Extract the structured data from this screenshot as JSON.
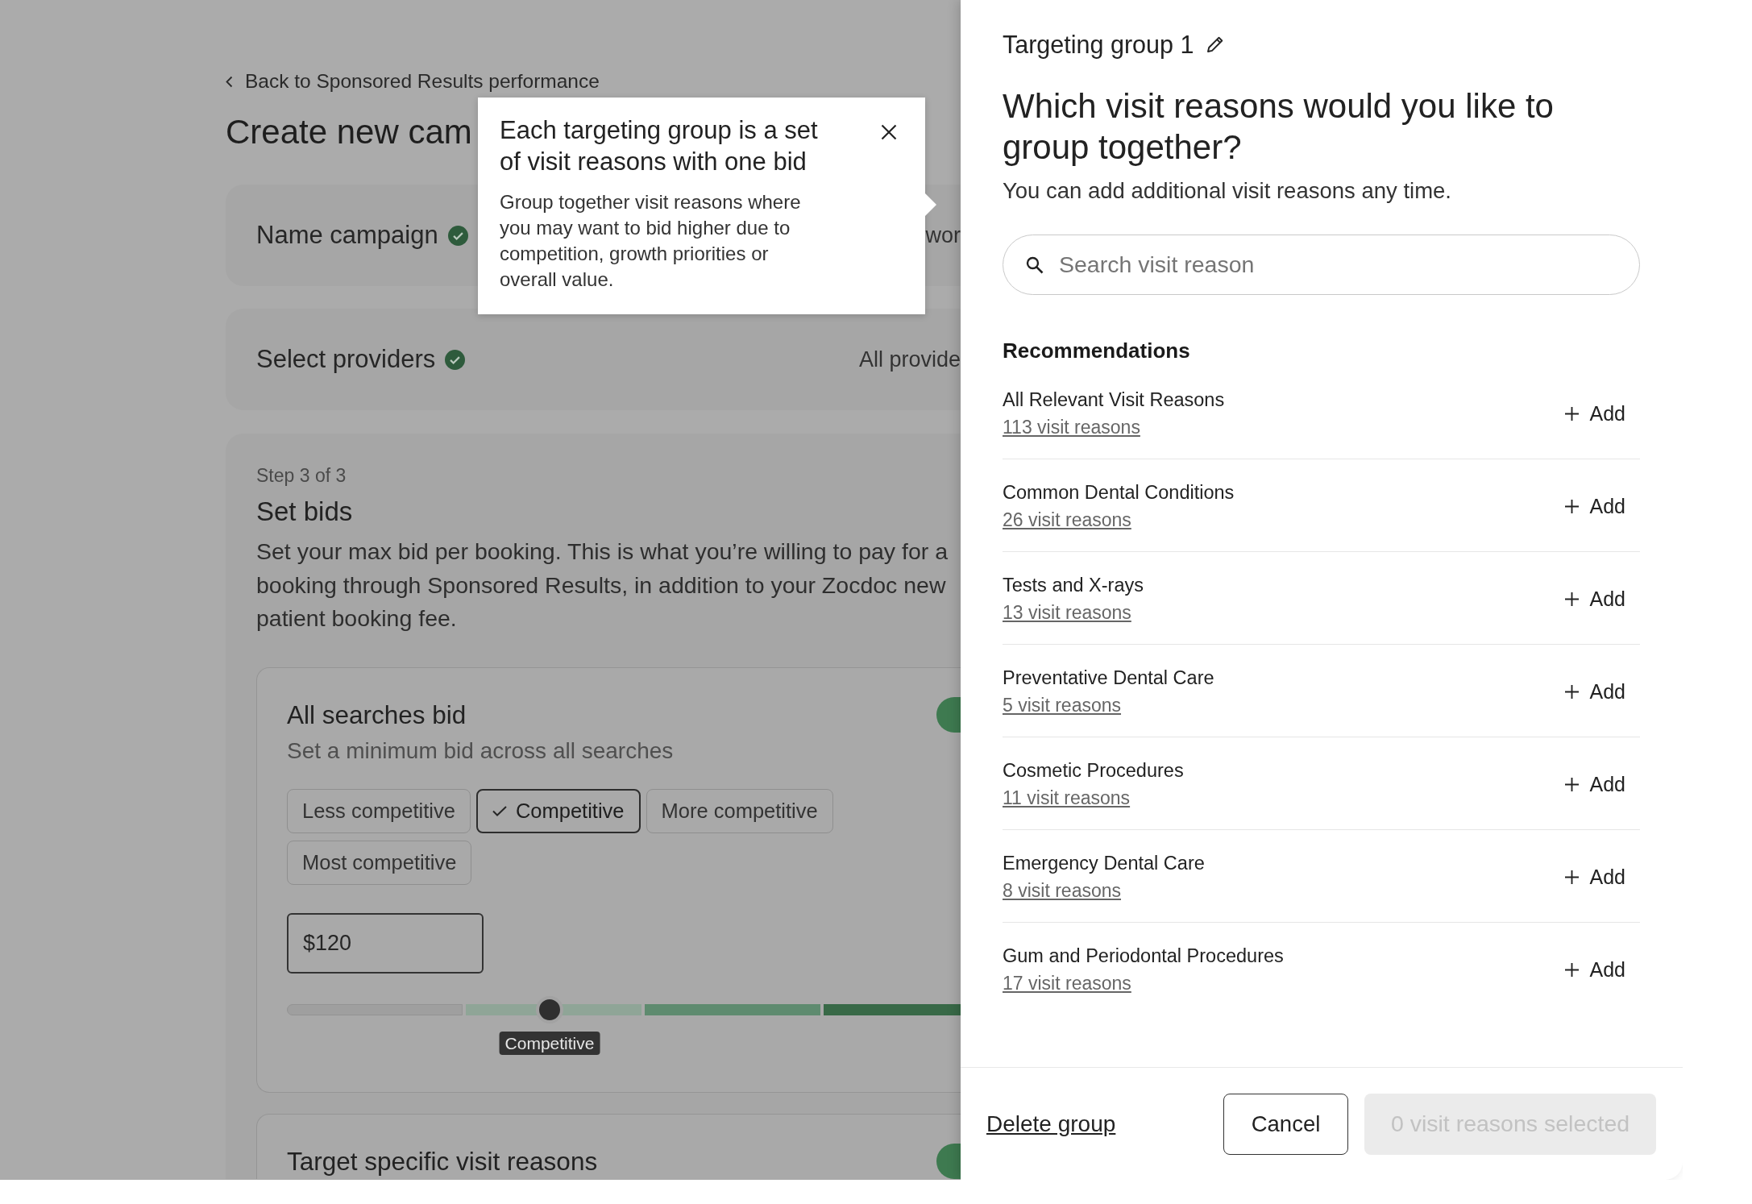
{
  "page": {
    "back_link": "Back to Sponsored Results performance",
    "title": "Create new cam",
    "completed_steps": [
      {
        "title": "Name campaign",
        "complete": true,
        "summary": "wor"
      },
      {
        "title": "Select providers",
        "complete": true,
        "summary": "All provide"
      }
    ],
    "current_step": {
      "step_label": "Step 3 of 3",
      "title": "Set bids",
      "description": "Set your max bid per booking. This is what you’re willing to pay for a booking through Sponsored Results, in addition to your Zocdoc new patient booking fee.",
      "sections": [
        {
          "title": "All searches bid",
          "on": true,
          "subtitle": "Set a minimum bid across all searches",
          "options": [
            {
              "label": "Less competitive",
              "selected": false
            },
            {
              "label": "Competitive",
              "selected": true
            },
            {
              "label": "More competitive",
              "selected": false
            },
            {
              "label": "Most competitive",
              "selected": false
            }
          ],
          "amount": "$120",
          "slider": {
            "level": 0.39,
            "label": "Competitive"
          }
        },
        {
          "title": "Target specific visit reasons",
          "on": true
        }
      ]
    }
  },
  "tooltip": {
    "title": "Each targeting group is a set of visit reasons with one bid",
    "body": "Group together visit reasons where you may want to bid higher due to competition, growth priorities or overall value."
  },
  "drawer": {
    "group_name": "Targeting group 1",
    "heading": "Which visit reasons would you like to group together?",
    "subheading": "You can add additional visit reasons any time.",
    "search": {
      "placeholder": "Search visit reason"
    },
    "section_title": "Recommendations",
    "recommendations": [
      {
        "name": "All Relevant Visit Reasons",
        "count": "113 visit reasons",
        "action": "Add"
      },
      {
        "name": "Common Dental Conditions",
        "count": "26 visit reasons",
        "action": "Add"
      },
      {
        "name": "Tests and X-rays",
        "count": "13 visit reasons",
        "action": "Add"
      },
      {
        "name": "Preventative Dental Care",
        "count": "5 visit reasons",
        "action": "Add"
      },
      {
        "name": "Cosmetic Procedures",
        "count": "11 visit reasons",
        "action": "Add"
      },
      {
        "name": "Emergency Dental Care",
        "count": "8 visit reasons",
        "action": "Add"
      },
      {
        "name": "Gum and Periodontal Procedures",
        "count": "17 visit reasons",
        "action": "Add"
      }
    ],
    "delete_link": "Delete group",
    "cancel_button": "Cancel",
    "confirm_button": {
      "label": "0 visit reasons selected",
      "disabled": true
    }
  }
}
